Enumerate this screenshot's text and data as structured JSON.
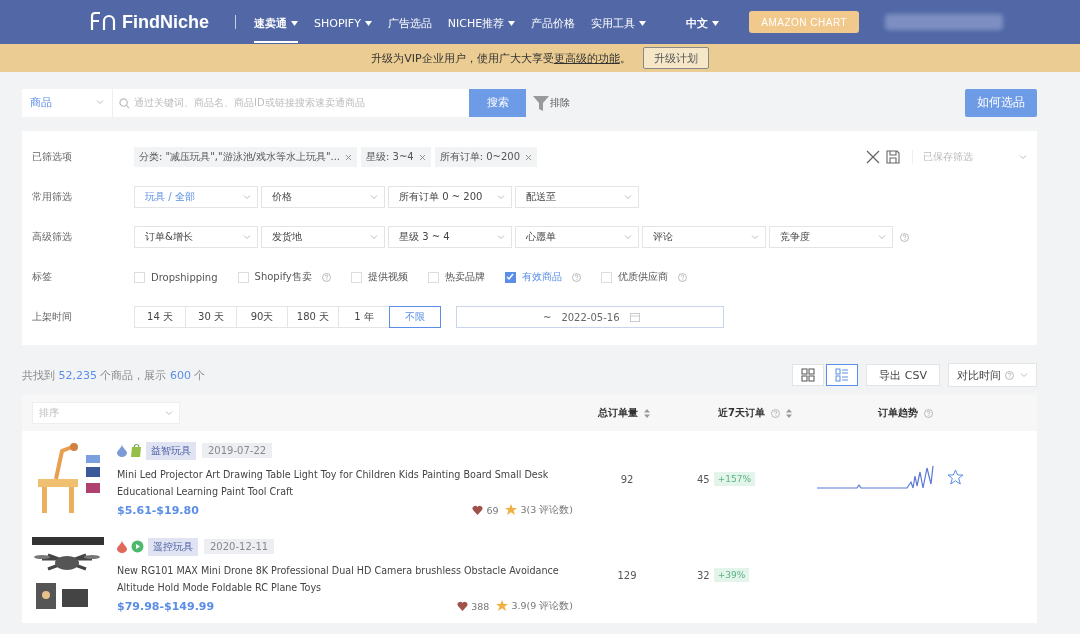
{
  "header": {
    "logo": "FindNiche",
    "nav": [
      {
        "label": "速卖通",
        "selected": true,
        "dropdown": true
      },
      {
        "label": "SHOPIFY",
        "selected": false,
        "dropdown": true
      },
      {
        "label": "广告选品",
        "selected": false,
        "dropdown": false
      },
      {
        "label": "NICHE推荐",
        "selected": false,
        "dropdown": true
      },
      {
        "label": "产品价格",
        "selected": false,
        "dropdown": false
      },
      {
        "label": "实用工具",
        "selected": false,
        "dropdown": true
      }
    ],
    "language": "中文",
    "chart_button": "AMAZON CHART"
  },
  "banner": {
    "prefix": "升级为VIP企业用户，使用广大大享受",
    "link": "更高级的功能",
    "suffix": "。",
    "button": "升级计划"
  },
  "search": {
    "type": "商品",
    "placeholder": "通过关键词、商品名、商品ID或链接搜索速卖通商品",
    "button": "搜索",
    "exclude": "排除",
    "help_button": "如何选品"
  },
  "filters": {
    "selected": {
      "label": "已筛选项",
      "chips": [
        "分类: \"减压玩具\",\"游泳池/戏水等水上玩具\"...",
        "星级: 3~4",
        "所有订单: 0~200"
      ],
      "saved": "已保存筛选"
    },
    "common": {
      "label": "常用筛选",
      "dropdowns": [
        {
          "label": "玩具 / 全部",
          "active": true
        },
        {
          "label": "价格",
          "active": false
        },
        {
          "label": "所有订单 0 ~ 200",
          "active": false
        },
        {
          "label": "配送至",
          "active": false
        }
      ]
    },
    "advanced": {
      "label": "高级筛选",
      "dropdowns": [
        {
          "label": "订单&增长",
          "active": false
        },
        {
          "label": "发货地",
          "active": false
        },
        {
          "label": "星级 3 ~ 4",
          "active": false
        },
        {
          "label": "心愿单",
          "active": false
        },
        {
          "label": "评论",
          "active": false
        },
        {
          "label": "竞争度",
          "active": false
        }
      ]
    },
    "tags": {
      "label": "标签",
      "items": [
        {
          "label": "Dropshipping",
          "checked": false,
          "help": false
        },
        {
          "label": "Shopify售卖",
          "checked": false,
          "help": true
        },
        {
          "label": "提供视频",
          "checked": false,
          "help": false
        },
        {
          "label": "热卖品牌",
          "checked": false,
          "help": false
        },
        {
          "label": "有效商品",
          "checked": true,
          "help": true
        },
        {
          "label": "优质供应商",
          "checked": false,
          "help": true
        }
      ]
    },
    "time": {
      "label": "上架时间",
      "options": [
        {
          "label": "14 天",
          "selected": false
        },
        {
          "label": "30 天",
          "selected": false
        },
        {
          "label": "90天",
          "selected": false
        },
        {
          "label": "180 天",
          "selected": false
        },
        {
          "label": "1 年",
          "selected": false
        },
        {
          "label": "不限",
          "selected": true
        }
      ],
      "range_separator": "~",
      "end_date": "2022-05-16"
    }
  },
  "results": {
    "prefix": "共找到",
    "count": "52,235",
    "middle": "个商品，展示",
    "shown": "600",
    "suffix": "个",
    "views": [
      {
        "kind": "grid",
        "selected": false
      },
      {
        "kind": "list",
        "selected": true
      }
    ],
    "export": "导出 CSV",
    "compare": "对比时间"
  },
  "table": {
    "sort_placeholder": "排序",
    "columns": [
      {
        "label": "总订单量",
        "help": false,
        "sortable": true
      },
      {
        "label": "近7天订单",
        "help": true,
        "sortable": true
      },
      {
        "label": "订单趋势",
        "help": true,
        "sortable": false
      }
    ],
    "rows": [
      {
        "color": "#7b9bd6",
        "kind": "shopify",
        "category": "益智玩具",
        "date": "2019-07-22",
        "title": "Mini Led Projector Art Drawing Table Light Toy for Children Kids Painting Board Small Desk Educational Learning Paint Tool Craft",
        "price": "$5.61-$19.80",
        "likes": "69",
        "rating": "3(3 评论数)",
        "total": "92",
        "week": "45",
        "growth": "+157%"
      },
      {
        "color": "#e0675a",
        "kind": "video",
        "category": "遥控玩具",
        "date": "2020-12-11",
        "title": "New RG101 MAX Mini Drone 8K Professional Dual HD Camera brushless Obstacle Avoidance Altitude Hold Mode Foldable RC Plane Toys",
        "price": "$79.98-$149.99",
        "likes": "388",
        "rating": "3.9(9 评论数)",
        "total": "129",
        "week": "32",
        "growth": "+39%"
      }
    ]
  }
}
